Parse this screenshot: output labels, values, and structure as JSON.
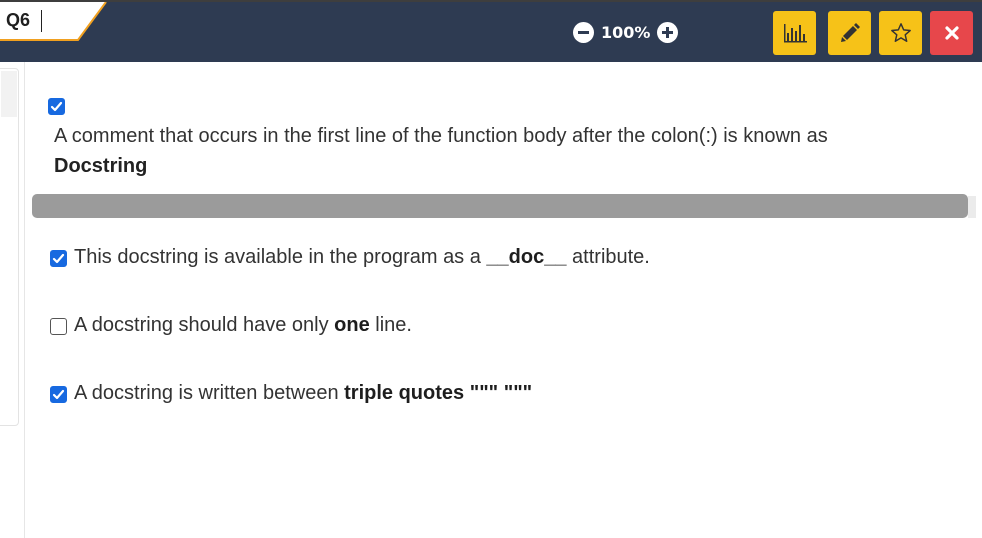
{
  "header": {
    "question_label": "Q6",
    "zoom_value": "100%",
    "colors": {
      "bar": "#2e3b52",
      "yellow": "#f6c218",
      "red": "#e7474b",
      "checkbox": "#1769e0"
    },
    "buttons": [
      "stats-icon",
      "pencil-icon",
      "star-icon",
      "close-icon"
    ]
  },
  "question": {
    "checked": true,
    "text": "A comment that occurs in the first line of the function body after the colon(:) is known as",
    "answer": "Docstring"
  },
  "options": [
    {
      "checked": true,
      "pre": "This docstring is available in the program as a ",
      "bold": "__doc__",
      "post": " attribute."
    },
    {
      "checked": false,
      "pre": "A docstring should have only ",
      "bold": "one",
      "post": " line."
    },
    {
      "checked": true,
      "pre": "A docstring is written between ",
      "bold": "triple quotes",
      "post": " \"\"\" \"\"\""
    }
  ]
}
